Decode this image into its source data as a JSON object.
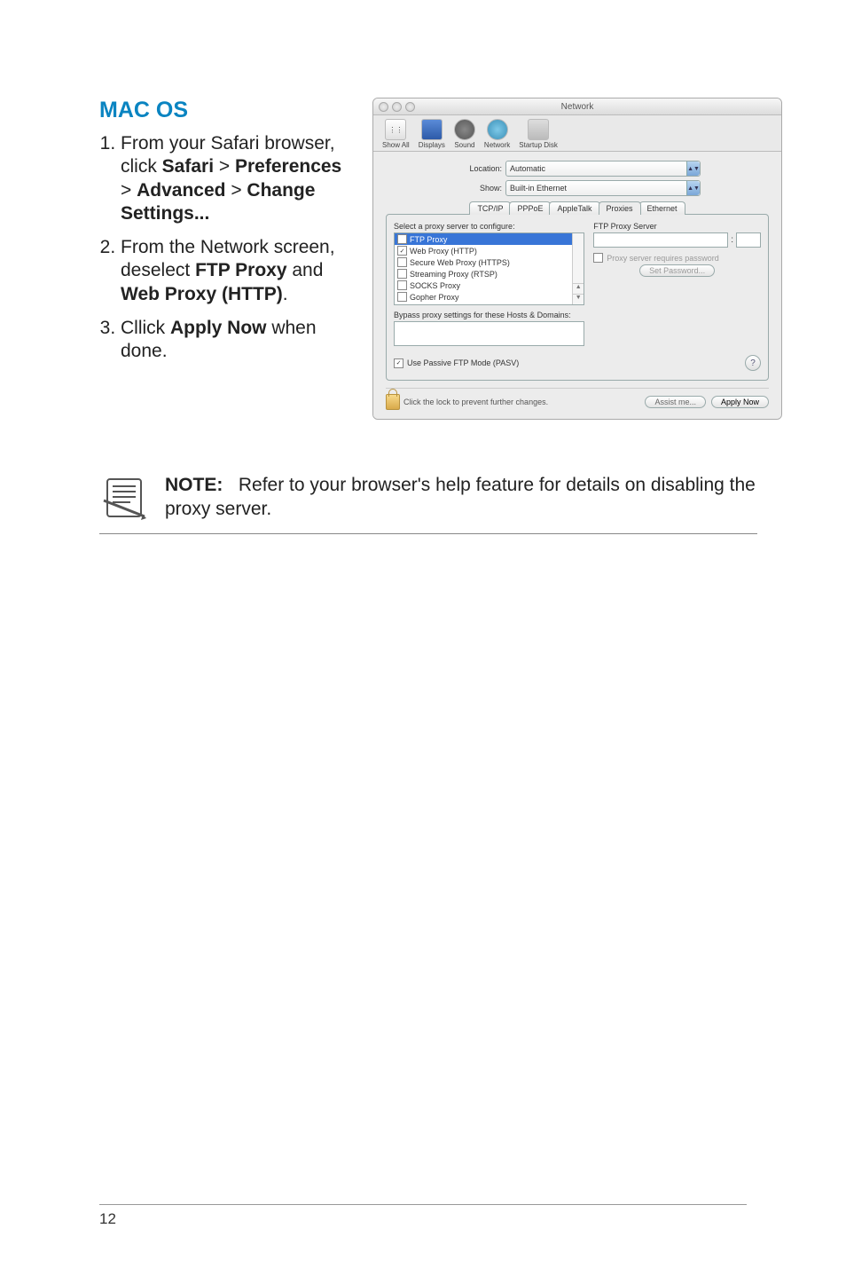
{
  "heading": "MAC OS",
  "steps": [
    {
      "prefix": "From your Safari browser, click ",
      "b1": "Safari",
      "sep1": " > ",
      "b2": "Preferences",
      "sep2": " > ",
      "b3": "Advanced",
      "sep3": " > ",
      "b4": "Change Settings..."
    },
    {
      "prefix": "From the Network screen, deselect ",
      "b1": "FTP Proxy",
      "mid": " and ",
      "b2": "Web Proxy (HTTP)",
      "suffix": "."
    },
    {
      "prefix": "Cllick ",
      "b1": "Apply Now",
      "suffix": " when done."
    }
  ],
  "note": {
    "label": "NOTE:",
    "text": "Refer to your browser's help feature for details on disabling the proxy server."
  },
  "page_number": "12",
  "screenshot": {
    "window_title": "Network",
    "toolbar": [
      "Show All",
      "Displays",
      "Sound",
      "Network",
      "Startup Disk"
    ],
    "location_label": "Location:",
    "location_value": "Automatic",
    "show_label": "Show:",
    "show_value": "Built-in Ethernet",
    "tabs": [
      "TCP/IP",
      "PPPoE",
      "AppleTalk",
      "Proxies",
      "Ethernet"
    ],
    "active_tab_index": 3,
    "select_proxy_label": "Select a proxy server to configure:",
    "proxy_list": [
      {
        "label": "FTP Proxy",
        "checked": true,
        "selected": true
      },
      {
        "label": "Web Proxy (HTTP)",
        "checked": true,
        "selected": false
      },
      {
        "label": "Secure Web Proxy (HTTPS)",
        "checked": false,
        "selected": false
      },
      {
        "label": "Streaming Proxy (RTSP)",
        "checked": false,
        "selected": false
      },
      {
        "label": "SOCKS Proxy",
        "checked": false,
        "selected": false
      },
      {
        "label": "Gopher Proxy",
        "checked": false,
        "selected": false
      }
    ],
    "ftp_server_label": "FTP Proxy Server",
    "requires_password_label": "Proxy server requires password",
    "set_password_btn": "Set Password...",
    "bypass_label": "Bypass proxy settings for these Hosts & Domains:",
    "passive_ftp_label": "Use Passive FTP Mode (PASV)",
    "lock_text": "Click the lock to prevent further changes.",
    "assist_btn": "Assist me...",
    "apply_btn": "Apply Now",
    "help": "?"
  }
}
